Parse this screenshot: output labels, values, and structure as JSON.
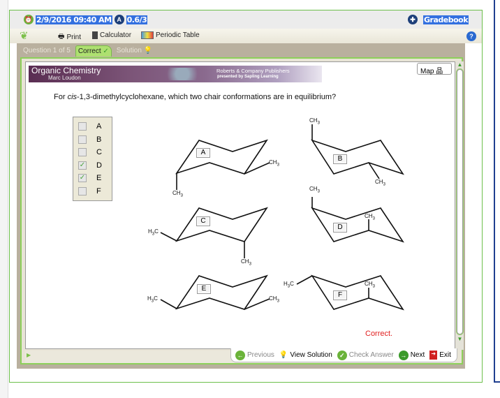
{
  "header": {
    "datetime": "2/9/2016 09:40 AM",
    "score": "0.6/3",
    "gradebook": "Gradebook"
  },
  "toolbar": {
    "print": "Print",
    "calculator": "Calculator",
    "periodic_table": "Periodic Table"
  },
  "tabs": {
    "question": "Question 1 of 5",
    "correct": "Correct",
    "solution": "Solution"
  },
  "banner": {
    "title": "Organic Chemistry",
    "author": "Marc Loudon",
    "publisher": "Roberts & Company Publishers",
    "presented": "presented by Sapling Learning"
  },
  "map_label": "Map",
  "question": {
    "prefix": "For ",
    "italic": "cis",
    "rest": "-1,3-dimethylcyclohexane, which two chair conformations are in equilibrium?"
  },
  "options": [
    {
      "label": "A",
      "checked": false
    },
    {
      "label": "B",
      "checked": false
    },
    {
      "label": "C",
      "checked": false
    },
    {
      "label": "D",
      "checked": true
    },
    {
      "label": "E",
      "checked": true
    },
    {
      "label": "F",
      "checked": false
    }
  ],
  "structures": {
    "A": "A",
    "B": "B",
    "C": "C",
    "D": "D",
    "E": "E",
    "F": "F",
    "ch3": "CH",
    "h3c": "H",
    "three": "3",
    "c": "C"
  },
  "feedback": "Correct.",
  "nav": {
    "previous": "Previous",
    "view_solution": "View Solution",
    "check_answer": "Check Answer",
    "next": "Next",
    "exit": "Exit"
  },
  "colors": {
    "accent_green": "#6cbf4a",
    "highlight": "#3370e0",
    "correct_red": "#e02020"
  }
}
